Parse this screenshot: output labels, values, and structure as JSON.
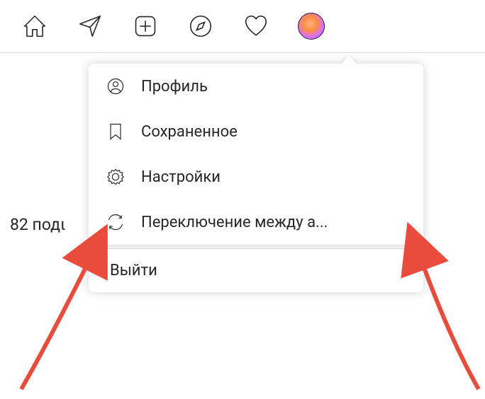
{
  "nav": {
    "home": "home-icon",
    "direct": "direct-icon",
    "new_post": "new-post-icon",
    "explore": "explore-icon",
    "activity": "activity-icon",
    "avatar": "profile-avatar"
  },
  "menu": {
    "profile": "Профиль",
    "saved": "Сохраненное",
    "settings": "Настройки",
    "switch": "Переключение между а...",
    "logout": "Выйти"
  },
  "background_text": "82 подι"
}
